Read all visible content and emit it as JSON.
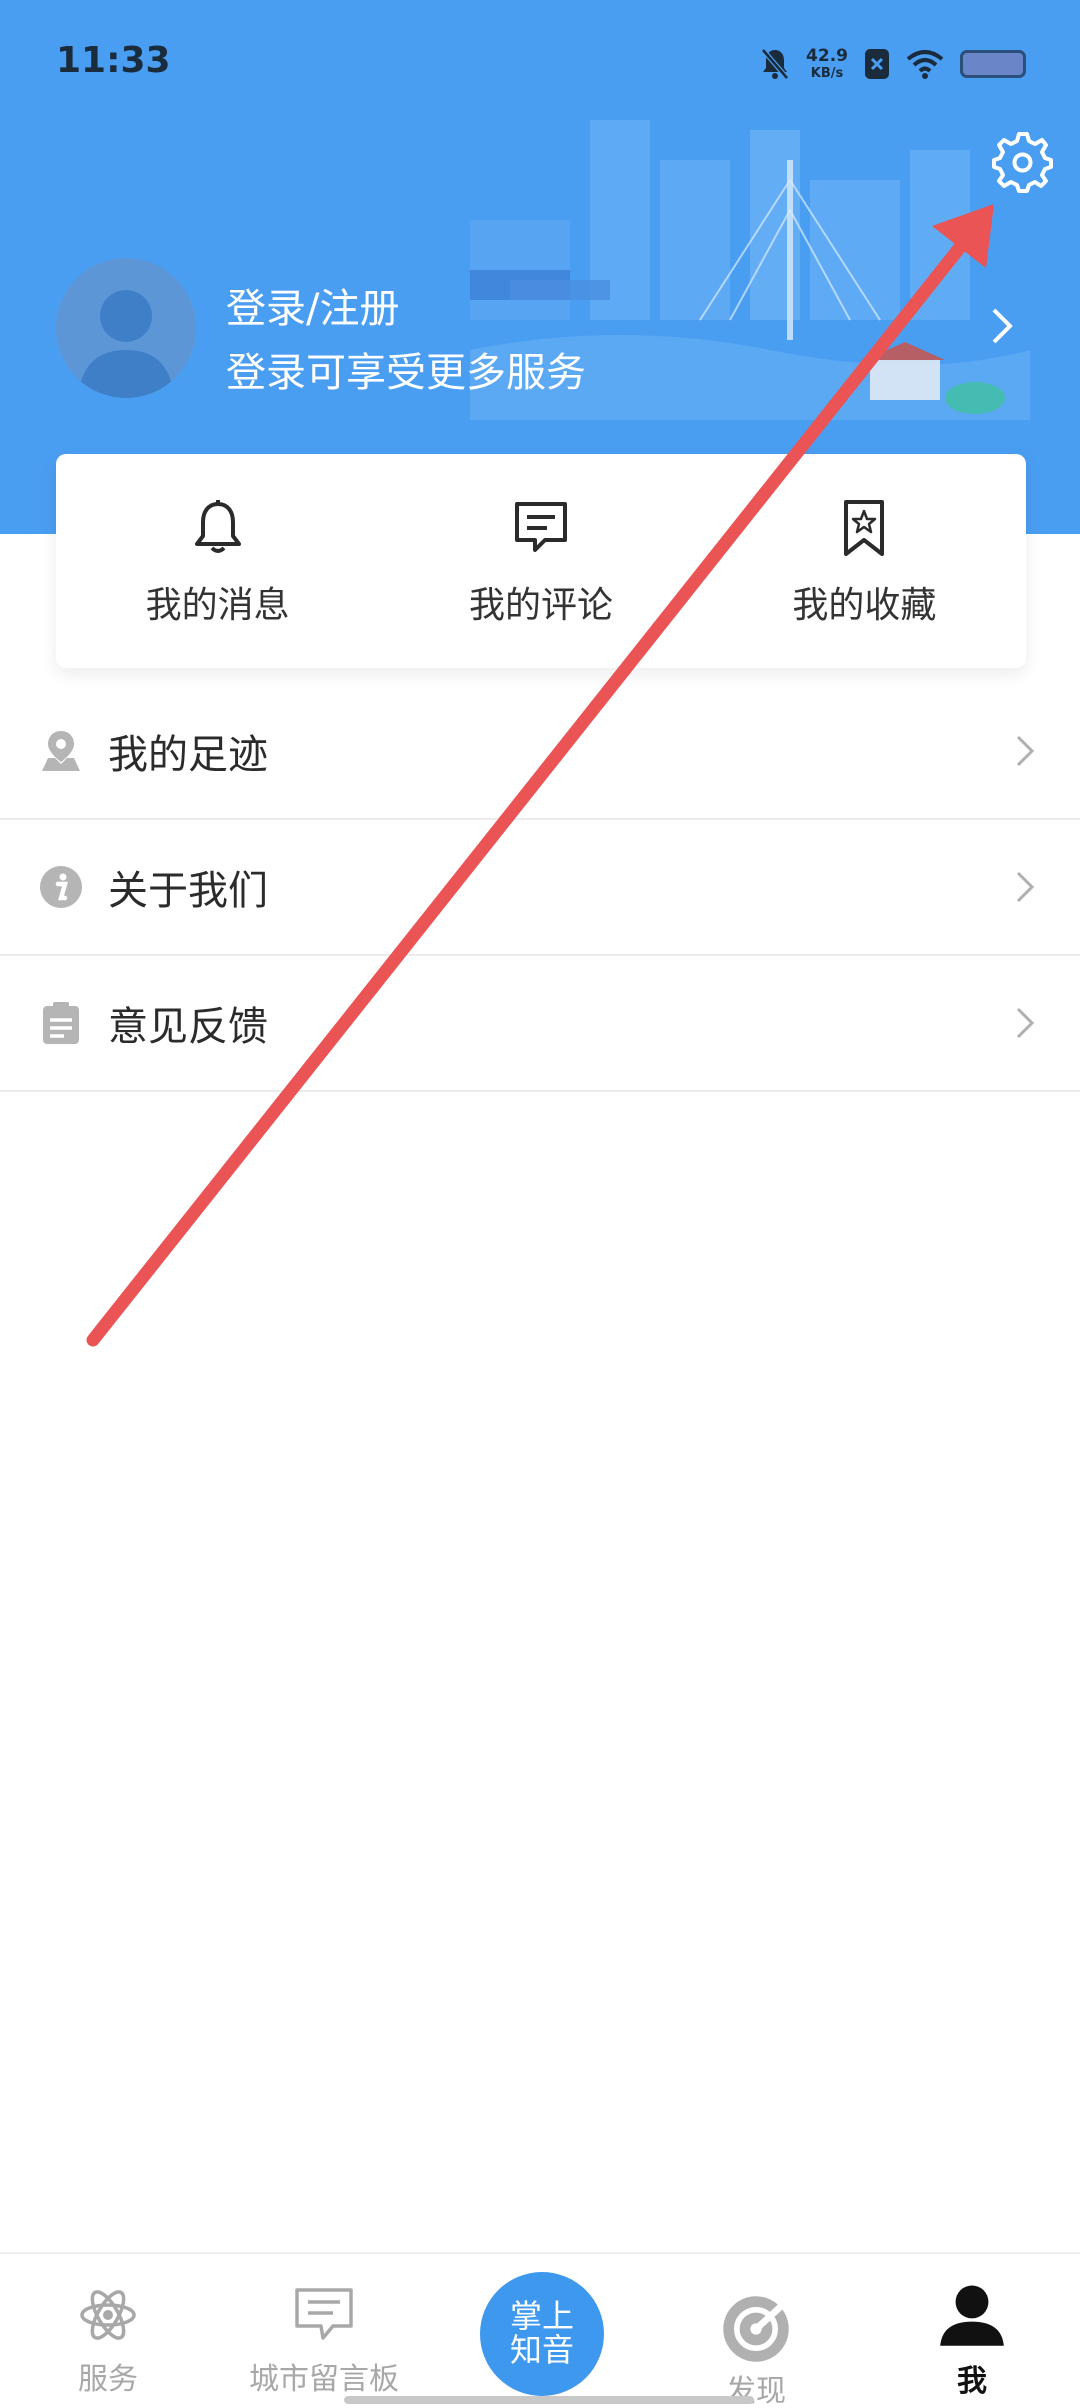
{
  "status_bar": {
    "time": "11:33",
    "speed_value": "42.9",
    "speed_unit": "KB/s"
  },
  "profile": {
    "title": "登录/注册",
    "subtitle": "登录可享受更多服务"
  },
  "quick_actions": [
    {
      "label": "我的消息",
      "icon": "bell-icon"
    },
    {
      "label": "我的评论",
      "icon": "comment-icon"
    },
    {
      "label": "我的收藏",
      "icon": "bookmark-icon"
    }
  ],
  "menu": [
    {
      "label": "我的足迹",
      "icon": "location-icon"
    },
    {
      "label": "关于我们",
      "icon": "info-icon"
    },
    {
      "label": "意见反馈",
      "icon": "clipboard-icon"
    }
  ],
  "bottom_nav": {
    "items": [
      {
        "label": "服务",
        "icon": "atom-icon"
      },
      {
        "label": "城市留言板",
        "icon": "message-board-icon"
      },
      {
        "label": "发现",
        "icon": "compass-icon"
      },
      {
        "label": "我",
        "icon": "person-icon"
      }
    ],
    "center_line1": "掌上",
    "center_line2": "知音",
    "active": "我"
  },
  "colors": {
    "header": "#4a9ef2",
    "accent": "#3e98ee",
    "annotation": "#ea5455"
  }
}
